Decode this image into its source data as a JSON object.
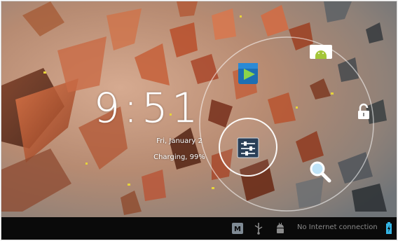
{
  "lockscreen": {
    "clock": "9:51",
    "date": "Fri, January 2",
    "battery_status": "Charging, 99%",
    "targets": [
      {
        "name": "play-store",
        "icon": "play-store-icon"
      },
      {
        "name": "camera",
        "icon": "android-camera-icon"
      },
      {
        "name": "unlock",
        "icon": "unlock-icon"
      },
      {
        "name": "search",
        "icon": "magnifier-icon"
      },
      {
        "name": "settings-handle",
        "icon": "sliders-icon"
      }
    ]
  },
  "status_bar": {
    "network": "No Internet connection",
    "icons": [
      "messenger-icon",
      "usb-icon",
      "android-debug-icon",
      "battery-charging-icon"
    ]
  },
  "colors": {
    "status_bar_bg": "#0a0a0a",
    "status_text": "#8a8a8a",
    "battery_accent": "#33b5e5",
    "wallpaper_base": "#b98a70"
  }
}
